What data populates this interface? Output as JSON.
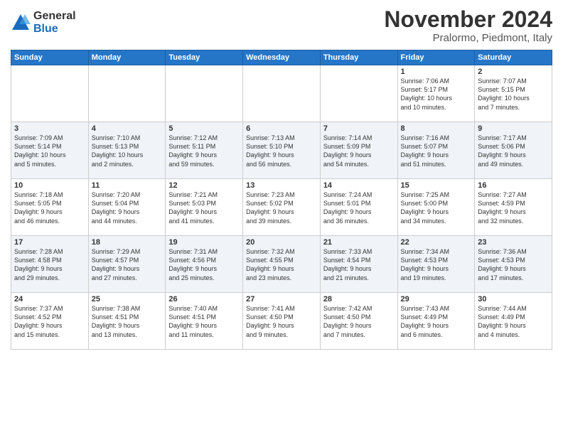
{
  "logo": {
    "general": "General",
    "blue": "Blue"
  },
  "title": "November 2024",
  "location": "Pralormo, Piedmont, Italy",
  "days_of_week": [
    "Sunday",
    "Monday",
    "Tuesday",
    "Wednesday",
    "Thursday",
    "Friday",
    "Saturday"
  ],
  "weeks": [
    [
      {
        "day": "",
        "info": ""
      },
      {
        "day": "",
        "info": ""
      },
      {
        "day": "",
        "info": ""
      },
      {
        "day": "",
        "info": ""
      },
      {
        "day": "",
        "info": ""
      },
      {
        "day": "1",
        "info": "Sunrise: 7:06 AM\nSunset: 5:17 PM\nDaylight: 10 hours\nand 10 minutes."
      },
      {
        "day": "2",
        "info": "Sunrise: 7:07 AM\nSunset: 5:15 PM\nDaylight: 10 hours\nand 7 minutes."
      }
    ],
    [
      {
        "day": "3",
        "info": "Sunrise: 7:09 AM\nSunset: 5:14 PM\nDaylight: 10 hours\nand 5 minutes."
      },
      {
        "day": "4",
        "info": "Sunrise: 7:10 AM\nSunset: 5:13 PM\nDaylight: 10 hours\nand 2 minutes."
      },
      {
        "day": "5",
        "info": "Sunrise: 7:12 AM\nSunset: 5:11 PM\nDaylight: 9 hours\nand 59 minutes."
      },
      {
        "day": "6",
        "info": "Sunrise: 7:13 AM\nSunset: 5:10 PM\nDaylight: 9 hours\nand 56 minutes."
      },
      {
        "day": "7",
        "info": "Sunrise: 7:14 AM\nSunset: 5:09 PM\nDaylight: 9 hours\nand 54 minutes."
      },
      {
        "day": "8",
        "info": "Sunrise: 7:16 AM\nSunset: 5:07 PM\nDaylight: 9 hours\nand 51 minutes."
      },
      {
        "day": "9",
        "info": "Sunrise: 7:17 AM\nSunset: 5:06 PM\nDaylight: 9 hours\nand 49 minutes."
      }
    ],
    [
      {
        "day": "10",
        "info": "Sunrise: 7:18 AM\nSunset: 5:05 PM\nDaylight: 9 hours\nand 46 minutes."
      },
      {
        "day": "11",
        "info": "Sunrise: 7:20 AM\nSunset: 5:04 PM\nDaylight: 9 hours\nand 44 minutes."
      },
      {
        "day": "12",
        "info": "Sunrise: 7:21 AM\nSunset: 5:03 PM\nDaylight: 9 hours\nand 41 minutes."
      },
      {
        "day": "13",
        "info": "Sunrise: 7:23 AM\nSunset: 5:02 PM\nDaylight: 9 hours\nand 39 minutes."
      },
      {
        "day": "14",
        "info": "Sunrise: 7:24 AM\nSunset: 5:01 PM\nDaylight: 9 hours\nand 36 minutes."
      },
      {
        "day": "15",
        "info": "Sunrise: 7:25 AM\nSunset: 5:00 PM\nDaylight: 9 hours\nand 34 minutes."
      },
      {
        "day": "16",
        "info": "Sunrise: 7:27 AM\nSunset: 4:59 PM\nDaylight: 9 hours\nand 32 minutes."
      }
    ],
    [
      {
        "day": "17",
        "info": "Sunrise: 7:28 AM\nSunset: 4:58 PM\nDaylight: 9 hours\nand 29 minutes."
      },
      {
        "day": "18",
        "info": "Sunrise: 7:29 AM\nSunset: 4:57 PM\nDaylight: 9 hours\nand 27 minutes."
      },
      {
        "day": "19",
        "info": "Sunrise: 7:31 AM\nSunset: 4:56 PM\nDaylight: 9 hours\nand 25 minutes."
      },
      {
        "day": "20",
        "info": "Sunrise: 7:32 AM\nSunset: 4:55 PM\nDaylight: 9 hours\nand 23 minutes."
      },
      {
        "day": "21",
        "info": "Sunrise: 7:33 AM\nSunset: 4:54 PM\nDaylight: 9 hours\nand 21 minutes."
      },
      {
        "day": "22",
        "info": "Sunrise: 7:34 AM\nSunset: 4:53 PM\nDaylight: 9 hours\nand 19 minutes."
      },
      {
        "day": "23",
        "info": "Sunrise: 7:36 AM\nSunset: 4:53 PM\nDaylight: 9 hours\nand 17 minutes."
      }
    ],
    [
      {
        "day": "24",
        "info": "Sunrise: 7:37 AM\nSunset: 4:52 PM\nDaylight: 9 hours\nand 15 minutes."
      },
      {
        "day": "25",
        "info": "Sunrise: 7:38 AM\nSunset: 4:51 PM\nDaylight: 9 hours\nand 13 minutes."
      },
      {
        "day": "26",
        "info": "Sunrise: 7:40 AM\nSunset: 4:51 PM\nDaylight: 9 hours\nand 11 minutes."
      },
      {
        "day": "27",
        "info": "Sunrise: 7:41 AM\nSunset: 4:50 PM\nDaylight: 9 hours\nand 9 minutes."
      },
      {
        "day": "28",
        "info": "Sunrise: 7:42 AM\nSunset: 4:50 PM\nDaylight: 9 hours\nand 7 minutes."
      },
      {
        "day": "29",
        "info": "Sunrise: 7:43 AM\nSunset: 4:49 PM\nDaylight: 9 hours\nand 6 minutes."
      },
      {
        "day": "30",
        "info": "Sunrise: 7:44 AM\nSunset: 4:49 PM\nDaylight: 9 hours\nand 4 minutes."
      }
    ]
  ]
}
